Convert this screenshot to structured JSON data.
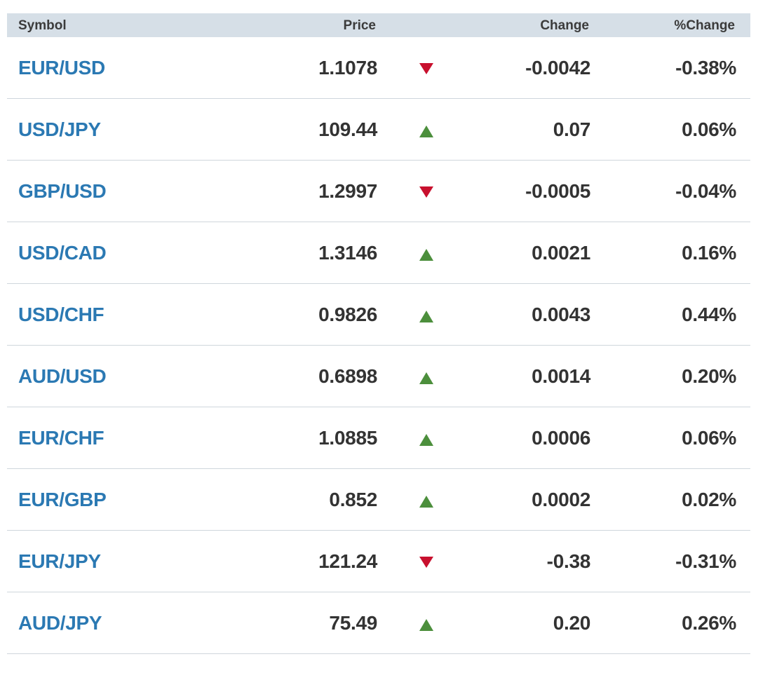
{
  "columns": {
    "symbol": "Symbol",
    "price": "Price",
    "change": "Change",
    "pct_change": "%Change"
  },
  "colors": {
    "header_bg": "#d6dfe7",
    "symbol_link": "#2b79b3",
    "down": "#c8102e",
    "up": "#4c8f3c"
  },
  "rows": [
    {
      "symbol": "EUR/USD",
      "price": "1.1078",
      "direction": "down",
      "change": "-0.0042",
      "pct_change": "-0.38%"
    },
    {
      "symbol": "USD/JPY",
      "price": "109.44",
      "direction": "up",
      "change": "0.07",
      "pct_change": "0.06%"
    },
    {
      "symbol": "GBP/USD",
      "price": "1.2997",
      "direction": "down",
      "change": "-0.0005",
      "pct_change": "-0.04%"
    },
    {
      "symbol": "USD/CAD",
      "price": "1.3146",
      "direction": "up",
      "change": "0.0021",
      "pct_change": "0.16%"
    },
    {
      "symbol": "USD/CHF",
      "price": "0.9826",
      "direction": "up",
      "change": "0.0043",
      "pct_change": "0.44%"
    },
    {
      "symbol": "AUD/USD",
      "price": "0.6898",
      "direction": "up",
      "change": "0.0014",
      "pct_change": "0.20%"
    },
    {
      "symbol": "EUR/CHF",
      "price": "1.0885",
      "direction": "up",
      "change": "0.0006",
      "pct_change": "0.06%"
    },
    {
      "symbol": "EUR/GBP",
      "price": "0.852",
      "direction": "up",
      "change": "0.0002",
      "pct_change": "0.02%"
    },
    {
      "symbol": "EUR/JPY",
      "price": "121.24",
      "direction": "down",
      "change": "-0.38",
      "pct_change": "-0.31%"
    },
    {
      "symbol": "AUD/JPY",
      "price": "75.49",
      "direction": "up",
      "change": "0.20",
      "pct_change": "0.26%"
    }
  ]
}
